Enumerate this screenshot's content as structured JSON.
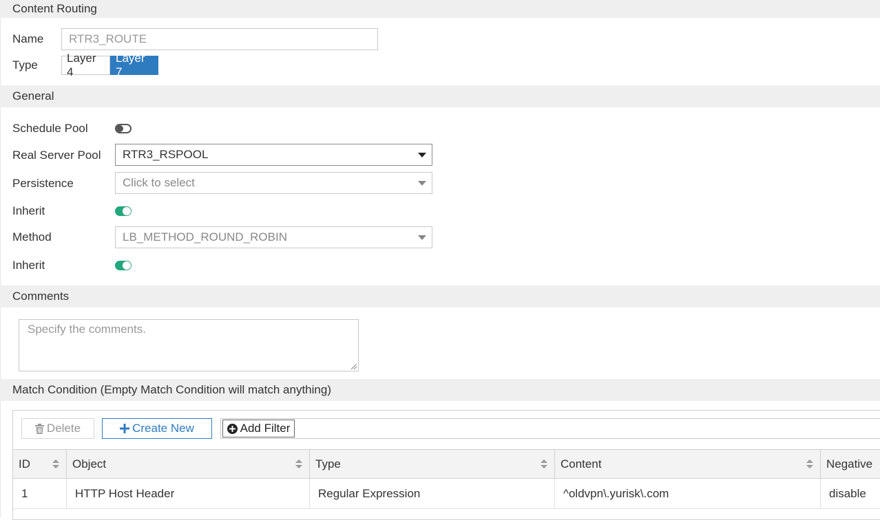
{
  "header": {
    "title": "Content Routing"
  },
  "name": {
    "label": "Name",
    "value": "RTR3_ROUTE"
  },
  "type": {
    "label": "Type",
    "options": [
      "Layer 4",
      "Layer 7"
    ],
    "selected": "Layer 7"
  },
  "general": {
    "title": "General",
    "schedule_pool": {
      "label": "Schedule Pool",
      "enabled": false
    },
    "real_server_pool": {
      "label": "Real Server Pool",
      "value": "RTR3_RSPOOL"
    },
    "persistence": {
      "label": "Persistence",
      "placeholder": "Click to select"
    },
    "persistence_inherit": {
      "label": "Inherit",
      "enabled": true
    },
    "method": {
      "label": "Method",
      "value": "LB_METHOD_ROUND_ROBIN"
    },
    "method_inherit": {
      "label": "Inherit",
      "enabled": true
    }
  },
  "comments": {
    "title": "Comments",
    "placeholder": "Specify the comments."
  },
  "match_condition": {
    "title": "Match Condition (Empty Match Condition will match anything)",
    "toolbar": {
      "delete_label": "Delete",
      "create_label": "Create New",
      "filter_label": "Add Filter"
    },
    "columns": [
      "ID",
      "Object",
      "Type",
      "Content",
      "Negative"
    ],
    "rows": [
      {
        "id": "1",
        "object": "HTTP Host Header",
        "type": "Regular Expression",
        "content": "^oldvpn\\.yurisk\\.com",
        "negative": "disable"
      }
    ]
  },
  "colors": {
    "accent": "#2f7bbf",
    "toggle_on": "#22a77e",
    "section_bg": "#efefef"
  }
}
